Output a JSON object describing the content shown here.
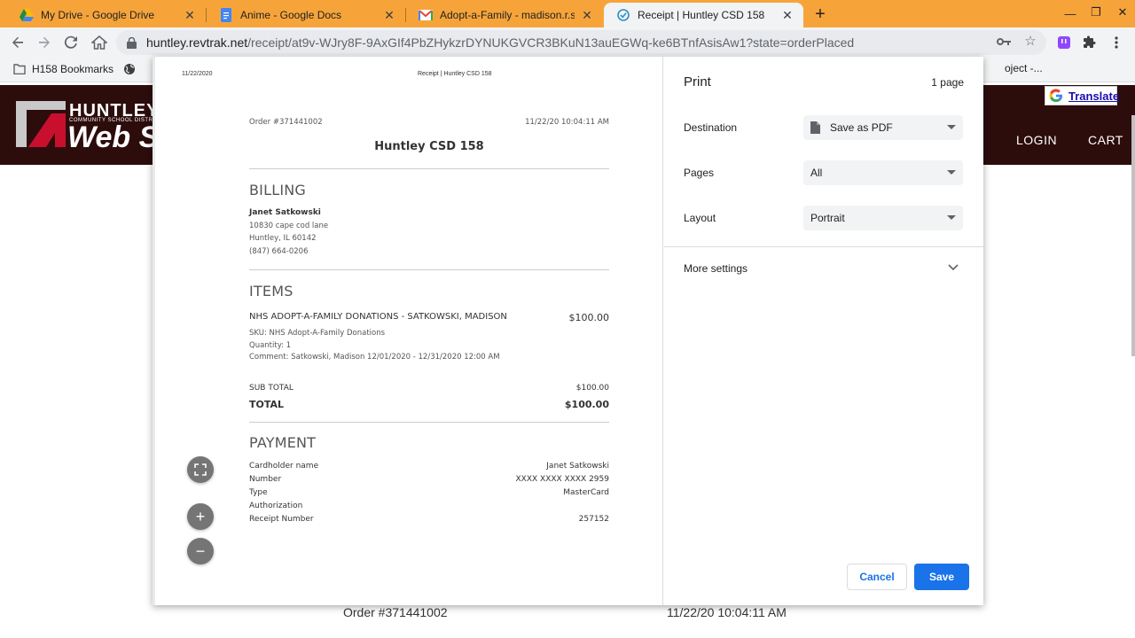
{
  "browser": {
    "tabs": [
      {
        "title": "My Drive - Google Drive",
        "icon": "google-drive-icon",
        "active": false
      },
      {
        "title": "Anime - Google Docs",
        "icon": "google-docs-icon",
        "active": false
      },
      {
        "title": "Adopt-a-Family - madison.r.satk",
        "icon": "gmail-icon",
        "active": false
      },
      {
        "title": "Receipt | Huntley CSD 158",
        "icon": "revtrak-icon",
        "active": true
      }
    ],
    "url_host": "huntley.revtrak.net",
    "url_path": "/receipt/at9v-WJry8F-9AxGIf4PbZHykzrDYNUKGVCR3BKuN13auEGWq-ke6BTnfAsisAw1?state=orderPlaced",
    "bookmarks": [
      {
        "label": "H158 Bookmarks",
        "icon": "folder-icon"
      }
    ],
    "bookmark_overflow_text": "oject -..."
  },
  "site": {
    "logo_line1": "HUNTLEY",
    "logo_line2": "COMMUNITY SCHOOL DISTRICT",
    "logo_line3": "Web S",
    "nav_login": "LOGIN",
    "nav_cart": "CART",
    "translate": "Translate",
    "bg_order": "Order #371441002",
    "bg_datetime": "11/22/20 10:04:11 AM",
    "colors": {
      "header_bg": "#2d0c0c",
      "tab_strip": "#f6a43a",
      "accent": "#1a73e8"
    }
  },
  "preview": {
    "page_date": "11/22/2020",
    "page_title": "Receipt | Huntley CSD 158",
    "order_number": "Order #371441002",
    "order_datetime": "11/22/20 10:04:11 AM",
    "org_name": "Huntley CSD 158",
    "billing": {
      "heading": "BILLING",
      "name": "Janet Satkowski",
      "address1": "10830 cape cod lane",
      "address2": "Huntley, IL 60142",
      "phone": "(847) 664-0206"
    },
    "items": {
      "heading": "ITEMS",
      "item_name": "NHS ADOPT-A-FAMILY DONATIONS - SATKOWSKI, MADISON",
      "item_price": "$100.00",
      "sku": "SKU: NHS Adopt-A-Family Donations",
      "quantity": "Quantity: 1",
      "comment": "Comment: Satkowski, Madison 12/01/2020 - 12/31/2020 12:00 AM"
    },
    "totals": {
      "subtotal_label": "SUB TOTAL",
      "subtotal_value": "$100.00",
      "total_label": "TOTAL",
      "total_value": "$100.00"
    },
    "payment": {
      "heading": "PAYMENT",
      "rows": [
        {
          "label": "Cardholder name",
          "value": "Janet Satkowski"
        },
        {
          "label": "Number",
          "value": "XXXX XXXX XXXX 2959"
        },
        {
          "label": "Type",
          "value": "MasterCard"
        },
        {
          "label": "Authorization",
          "value": ""
        },
        {
          "label": "Receipt Number",
          "value": "257152"
        }
      ]
    }
  },
  "print": {
    "title": "Print",
    "page_count": "1 page",
    "destination_label": "Destination",
    "destination_value": "Save as PDF",
    "pages_label": "Pages",
    "pages_value": "All",
    "layout_label": "Layout",
    "layout_value": "Portrait",
    "more_settings": "More settings",
    "cancel": "Cancel",
    "save": "Save"
  }
}
